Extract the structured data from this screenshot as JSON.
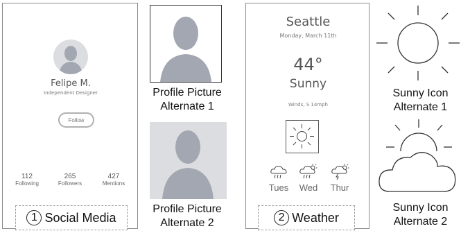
{
  "social_card": {
    "name": "Felipe M.",
    "title": "Independent Designer",
    "follow_label": "Follow",
    "stats": [
      {
        "value": "112",
        "label": "Following"
      },
      {
        "value": "265",
        "label": "Followers"
      },
      {
        "value": "427",
        "label": "Mentions"
      }
    ],
    "tag_number": "1",
    "tag_label": "Social Media"
  },
  "profile_pictures": {
    "caption_1": [
      "Profile Picture",
      "Alternate 1"
    ],
    "caption_2": [
      "Profile Picture",
      "Alternate 2"
    ]
  },
  "weather_card": {
    "city": "Seattle",
    "date": "Monday, March 11th",
    "temperature": "44°",
    "condition": "Sunny",
    "wind": "Winds, S 14mph",
    "forecast": [
      {
        "day": "Tues",
        "icon": "rain-cloud-icon"
      },
      {
        "day": "Wed",
        "icon": "rain-sun-cloud-icon"
      },
      {
        "day": "Thur",
        "icon": "storm-sun-cloud-icon"
      }
    ],
    "tag_number": "2",
    "tag_label": "Weather"
  },
  "sunny_icons": {
    "caption_1": [
      "Sunny Icon",
      "Alternate 1"
    ],
    "caption_2": [
      "Sunny Icon",
      "Alternate 2"
    ]
  },
  "colors": {
    "avatar_bg": "#dcdde0",
    "avatar_silhouette": "#a2a7b1",
    "frame": "#8a8a8a"
  }
}
